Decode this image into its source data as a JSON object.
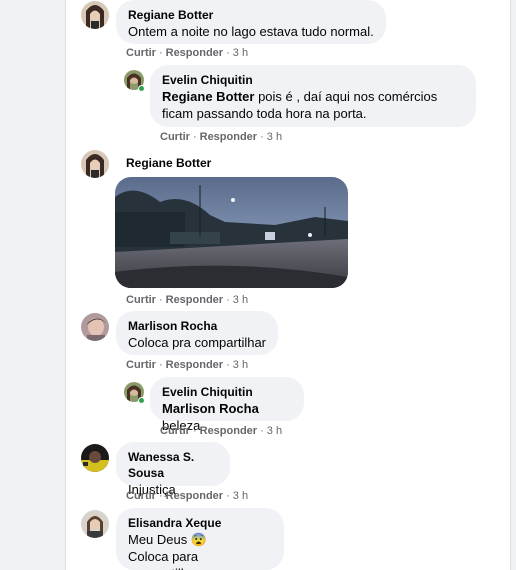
{
  "comments": [
    {
      "author": "Regiane Botter",
      "text": "Ontem a noite no lago estava tudo normal.",
      "like": "Curtir",
      "reply": "Responder",
      "time": "3 h"
    },
    {
      "author": "Evelin Chiquitin",
      "mention": "Regiane Botter",
      "text_line1": " pois é , daí aqui nos comércios",
      "text_line2": "ficam passando toda hora na porta.",
      "like": "Curtir",
      "reply": "Responder",
      "time": "3 h"
    },
    {
      "author": "Regiane Botter",
      "image_alt": "night street photo",
      "like": "Curtir",
      "reply": "Responder",
      "time": "3 h"
    },
    {
      "author": "Marlison Rocha",
      "text": "Coloca pra compartilhar",
      "like": "Curtir",
      "reply": "Responder",
      "time": "3 h"
    },
    {
      "author": "Evelin Chiquitin",
      "mention": "Marlison Rocha",
      "text": " beleza",
      "like": "Curtir",
      "reply": "Responder",
      "time": "3 h"
    },
    {
      "author": "Wanessa S. Sousa",
      "text": "Injustiça",
      "like": "Curtir",
      "reply": "Responder",
      "time": "3 h"
    },
    {
      "author": "Elisandra Xeque",
      "text_line1": "Meu Deus 😨",
      "text_line2": "Coloca para compartilhar"
    }
  ],
  "separator": "·",
  "colors": {
    "bubble": "#f0f2f5",
    "secondary_text": "#65676b",
    "online": "#31a24c"
  }
}
